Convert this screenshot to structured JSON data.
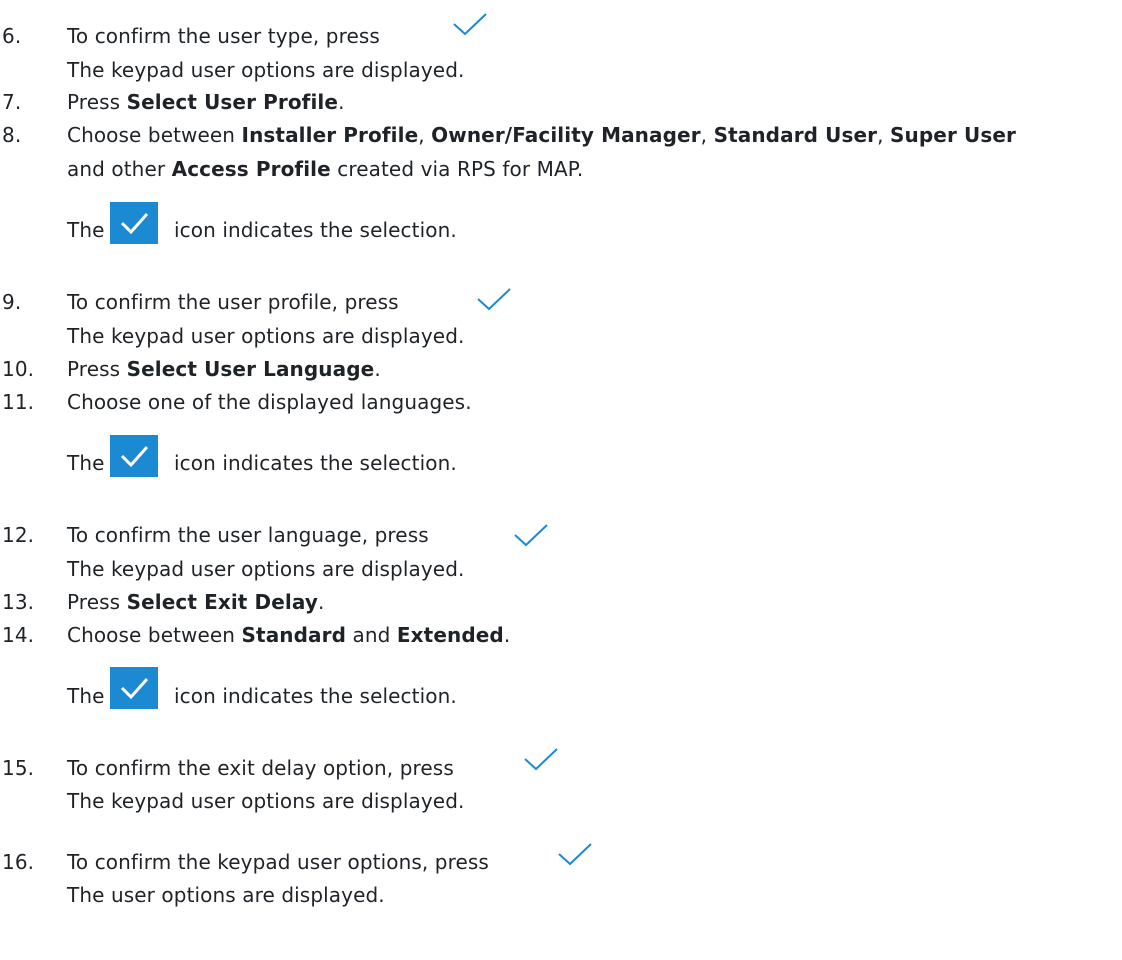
{
  "steps": [
    {
      "num": "6.",
      "pre": "To confirm the user type, press",
      "sub": "The keypad user options are displayed."
    },
    {
      "num": "7.",
      "pre": "Press ",
      "b1": "Select User Profile",
      "post": "."
    },
    {
      "num": "8.",
      "pre": "Choose between ",
      "b1": "Installer Profile",
      "c1": ", ",
      "b2": "Owner/Facility Manager",
      "c2": ", ",
      "b3": "Standard User",
      "c3": ", ",
      "b4": "Super User",
      "line2_pre": "and other ",
      "line2_b": "Access Profile",
      "line2_post": " created via RPS for MAP."
    },
    {
      "num": "9.",
      "pre": "To confirm the user profile, press",
      "sub": "The keypad user options are displayed."
    },
    {
      "num": "10.",
      "pre": "Press ",
      "b1": "Select User Language",
      "post": "."
    },
    {
      "num": "11.",
      "pre": "Choose one of the displayed languages."
    },
    {
      "num": "12.",
      "pre": "To confirm the user language, press",
      "sub": "The keypad user options are displayed."
    },
    {
      "num": "13.",
      "pre": "Press ",
      "b1": "Select Exit Delay",
      "post": "."
    },
    {
      "num": "14.",
      "pre": "Choose between ",
      "b1": "Standard",
      "c1": " and ",
      "b2": "Extended",
      "post": "."
    },
    {
      "num": "15.",
      "pre": "To confirm the exit delay option, press",
      "sub": "The keypad user options are displayed."
    },
    {
      "num": "16.",
      "pre": "To confirm the keypad user options, press",
      "sub": "The user options are displayed."
    }
  ],
  "selection_note": {
    "the": "The",
    "rest": "icon indicates the selection."
  },
  "colors": {
    "check_blue": "#1b8ad3",
    "text": "#1f2328"
  },
  "icons": {
    "confirm": "checkmark-icon",
    "selected": "checked-box-icon"
  }
}
